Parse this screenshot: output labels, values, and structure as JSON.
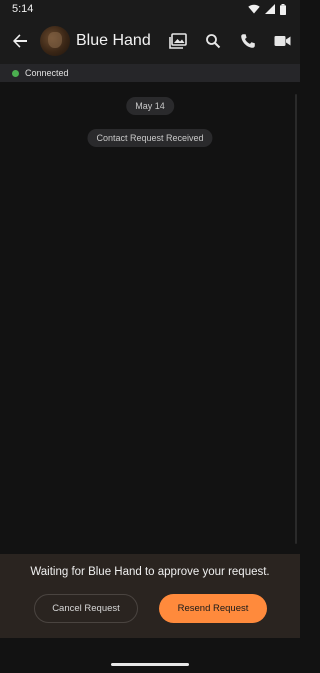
{
  "status_bar": {
    "time": "5:14"
  },
  "header": {
    "contact_name": "Blue Hand",
    "icons": [
      "back-arrow-icon",
      "gallery-icon",
      "search-icon",
      "phone-icon",
      "video-call-icon"
    ]
  },
  "connection": {
    "label": "Connected",
    "color": "#4caf50"
  },
  "chat": {
    "date_label": "May 14",
    "system_message": "Contact Request Received"
  },
  "footer": {
    "waiting_text": "Waiting for Blue Hand to approve your request.",
    "cancel_label": "Cancel Request",
    "resend_label": "Resend Request",
    "accent_color": "#ff8a3c"
  }
}
